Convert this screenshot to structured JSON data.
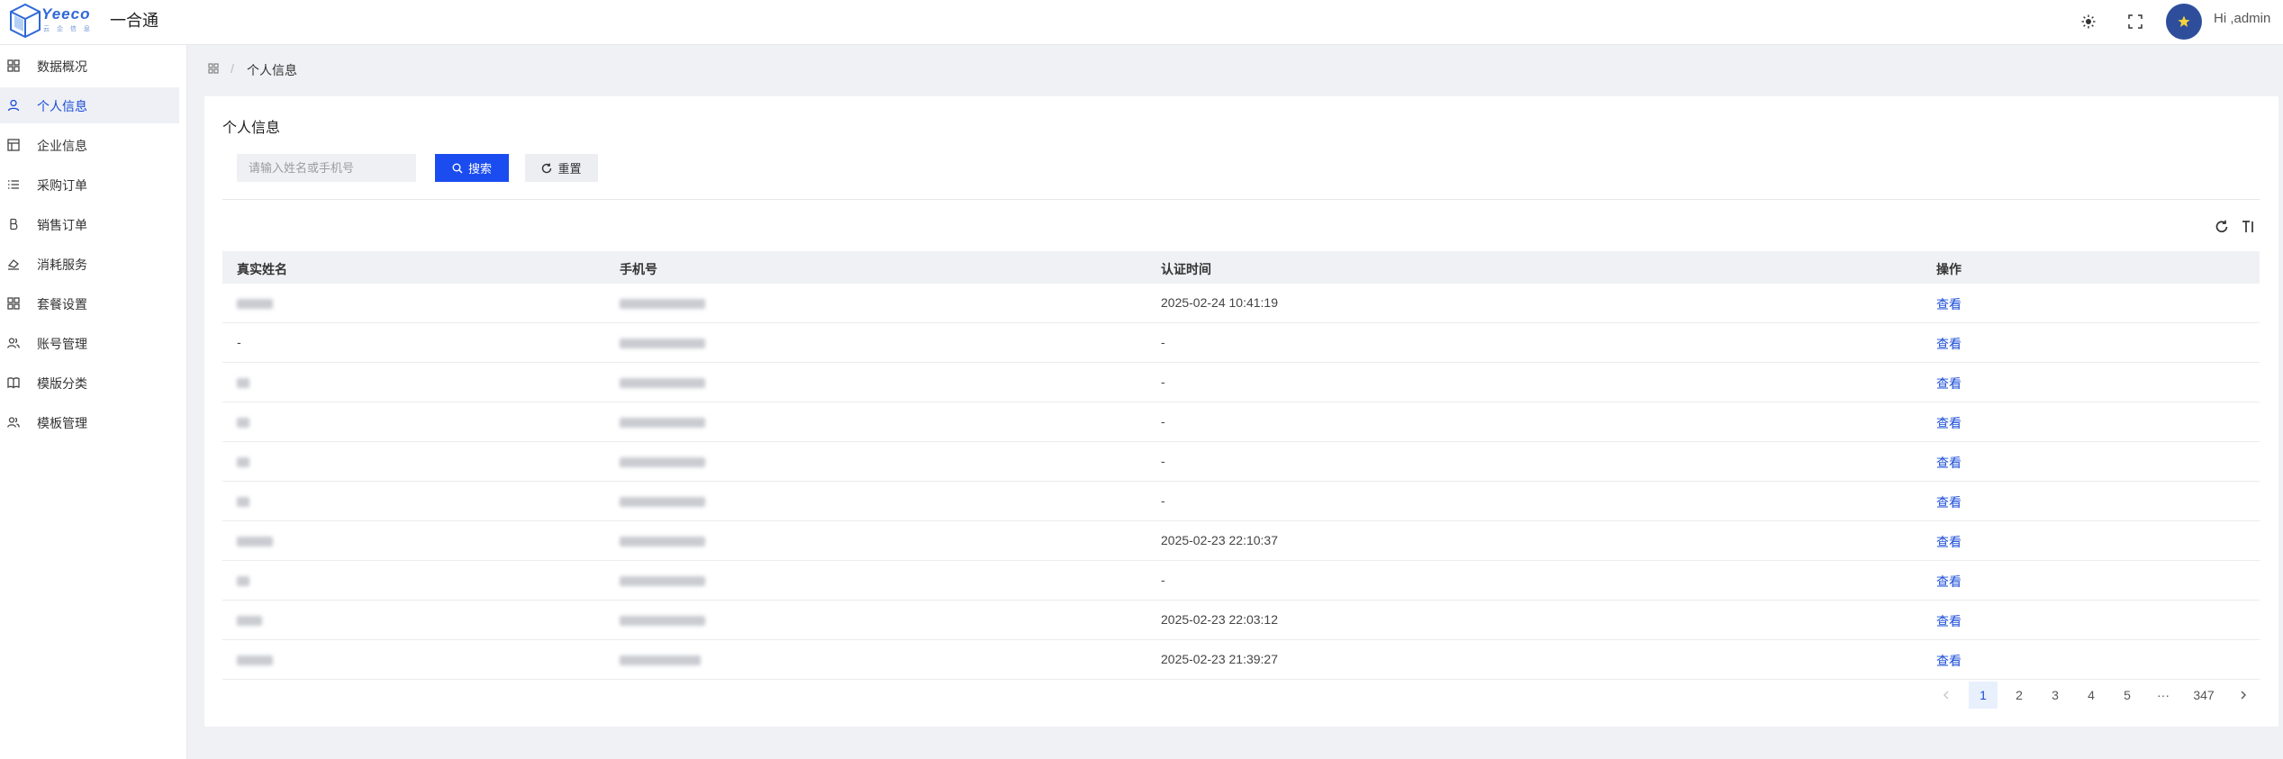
{
  "header": {
    "logo_text": "Yeeco",
    "logo_sub": "云 企 信 息",
    "app_title": "一合通",
    "greeting": "Hi ,admin"
  },
  "sidebar": {
    "items": [
      {
        "label": "数据概况",
        "icon": "dashboard-icon"
      },
      {
        "label": "个人信息",
        "icon": "user-icon",
        "active": true
      },
      {
        "label": "企业信息",
        "icon": "enterprise-icon"
      },
      {
        "label": "采购订单",
        "icon": "list-icon"
      },
      {
        "label": "销售订单",
        "icon": "bitcoin-icon"
      },
      {
        "label": "消耗服务",
        "icon": "eraser-icon"
      },
      {
        "label": "套餐设置",
        "icon": "grid-icon"
      },
      {
        "label": "账号管理",
        "icon": "users-icon"
      },
      {
        "label": "模版分类",
        "icon": "book-icon"
      },
      {
        "label": "模板管理",
        "icon": "users-icon"
      }
    ]
  },
  "breadcrumb": {
    "current": "个人信息"
  },
  "page": {
    "title": "个人信息",
    "search_placeholder": "请输入姓名或手机号",
    "search_label": "搜索",
    "reset_label": "重置"
  },
  "table": {
    "columns": [
      "真实姓名",
      "手机号",
      "认证时间",
      "操作"
    ],
    "rows": [
      {
        "time": "2025-02-24 10:41:19",
        "action": "查看"
      },
      {
        "name": "-",
        "time": "-",
        "action": "查看"
      },
      {
        "time": "-",
        "action": "查看"
      },
      {
        "time": "-",
        "action": "查看"
      },
      {
        "time": "-",
        "action": "查看"
      },
      {
        "time": "-",
        "action": "查看"
      },
      {
        "time": "2025-02-23 22:10:37",
        "action": "查看"
      },
      {
        "time": "-",
        "action": "查看"
      },
      {
        "time": "2025-02-23 22:03:12",
        "action": "查看"
      },
      {
        "time": "2025-02-23 21:39:27",
        "action": "查看"
      }
    ]
  },
  "pagination": {
    "pages": [
      "1",
      "2",
      "3",
      "4",
      "5",
      "···",
      "347"
    ],
    "current": "1"
  },
  "colors": {
    "accent": "#1a4cf0",
    "link": "#1a4cd7",
    "avatar": "#2e4e9c"
  }
}
